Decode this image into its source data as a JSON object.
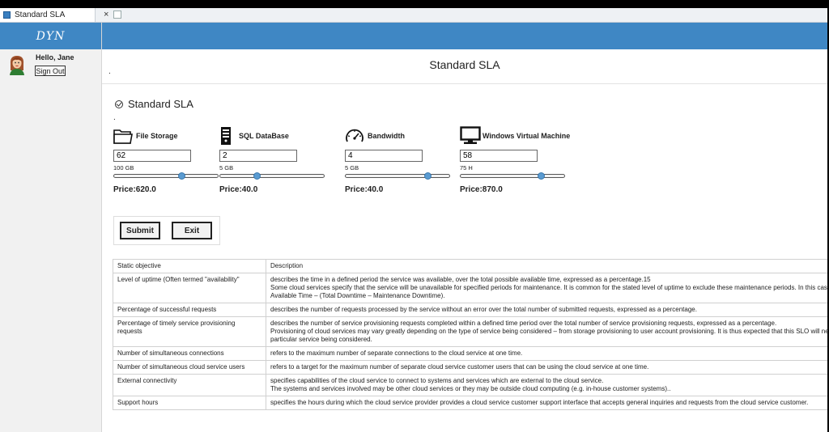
{
  "browser": {
    "tab_title": "Standard SLA",
    "tab_close": "×"
  },
  "app": {
    "brand": "DYN"
  },
  "user": {
    "greeting": "Hello, Jane",
    "signout_label": "Sign Out"
  },
  "header": {
    "bullet": ".",
    "title": "Standard SLA"
  },
  "section": {
    "title": "Standard SLA",
    "bullet": "."
  },
  "resources": [
    {
      "name": "File Storage",
      "icon": "folder-icon",
      "value": "62",
      "max_label": "100 GB",
      "slider_fraction": 0.62,
      "price": "Price:620.0"
    },
    {
      "name": "SQL DataBase",
      "icon": "database-server-icon",
      "value": "2",
      "max_label": "5 GB",
      "slider_fraction": 0.4,
      "price": "Price:40.0"
    },
    {
      "name": "Bandwidth",
      "icon": "speedometer-icon",
      "value": "4",
      "max_label": "5 GB",
      "slider_fraction": 0.8,
      "price": "Price:40.0"
    },
    {
      "name": "Windows Virtual Machine",
      "icon": "monitor-icon",
      "value": "58",
      "max_label": "75 H",
      "slider_fraction": 0.77,
      "price": "Price:870.0"
    }
  ],
  "actions": {
    "submit_label": "Submit",
    "exit_label": "Exit"
  },
  "table": {
    "headers": [
      "Static objective",
      "Description"
    ],
    "rows": [
      {
        "objective": "Level of uptime (Often termed \"availability\"",
        "lines": [
          "describes the time in a defined period the service was available, over the total possible available time, expressed as a percentage.15",
          "Some cloud services specify that the service will be unavailable for specified periods for maintenance. It is common for the stated level of uptime to exclude these maintenance periods. In this case Uptime = Total Possible",
          "Available Time – (Total Downtime – Maintenance Downtime)."
        ]
      },
      {
        "objective": "Percentage of successful requests",
        "lines": [
          "describes the number of requests processed by the service without an error over the total number of submitted requests, expressed as a percentage."
        ]
      },
      {
        "objective": "Percentage of timely service provisioning requests",
        "lines": [
          "describes the number of service provisioning requests completed within a defined time period over the total number of service provisioning requests, expressed as a percentage.",
          "Provisioning of cloud services may vary greatly depending on the type of service being considered – from storage provisioning to user account provisioning. It is thus expected that this SLO will need to be tailored to the",
          "particular service being considered."
        ]
      },
      {
        "objective": "Number of simultaneous connections",
        "lines": [
          "refers to the maximum number of separate connections to the cloud service at one time."
        ]
      },
      {
        "objective": "Number of simultaneous cloud service users",
        "lines": [
          "refers to a target for the maximum number of separate cloud service customer users that can be using the cloud service at one time."
        ]
      },
      {
        "objective": "External connectivity",
        "lines": [
          "specifies capabilities of the cloud service to connect to systems and services which are external to the cloud service.",
          "The systems and services involved may be other cloud services or they may be outside cloud computing (e.g. in-house customer systems).."
        ]
      },
      {
        "objective": "Support hours",
        "lines": [
          "specifies the hours during which the cloud service provider provides a cloud service customer support interface that accepts general inquiries and requests from the cloud service customer."
        ]
      }
    ]
  },
  "colors": {
    "accent": "#3f87c4",
    "slider_knob": "#5a9bd1"
  }
}
